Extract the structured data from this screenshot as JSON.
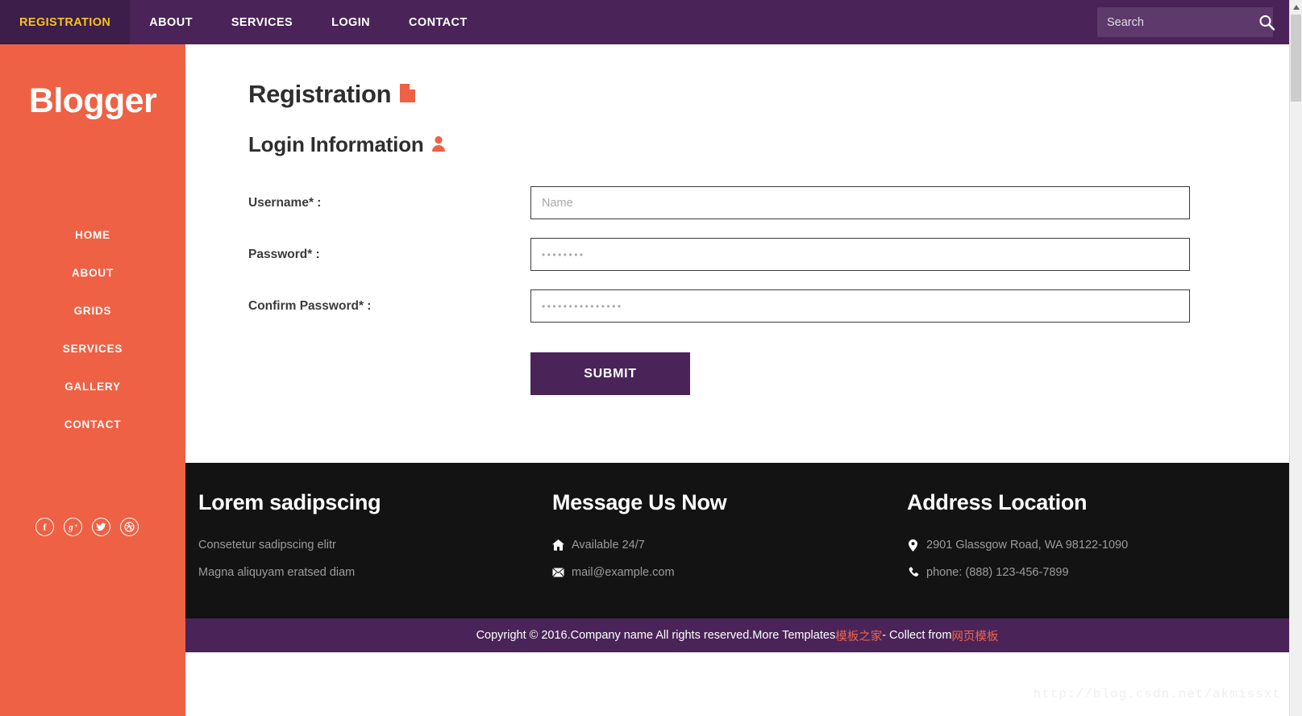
{
  "topnav": {
    "items": [
      {
        "label": "REGISTRATION",
        "active": true
      },
      {
        "label": "ABOUT",
        "active": false
      },
      {
        "label": "SERVICES",
        "active": false
      },
      {
        "label": "LOGIN",
        "active": false
      },
      {
        "label": "CONTACT",
        "active": false
      }
    ],
    "search": {
      "placeholder": "Search",
      "value": "",
      "icon": "search-icon"
    },
    "bg_color": "#4a2458",
    "active_color": "#f3c41c"
  },
  "sidebar": {
    "logo": "Blogger",
    "bg_color": "#ef6144",
    "items": [
      {
        "label": "HOME"
      },
      {
        "label": "ABOUT"
      },
      {
        "label": "GRIDS"
      },
      {
        "label": "SERVICES"
      },
      {
        "label": "GALLERY"
      },
      {
        "label": "CONTACT"
      }
    ],
    "socials": [
      {
        "name": "facebook-icon"
      },
      {
        "name": "google-plus-icon"
      },
      {
        "name": "twitter-icon"
      },
      {
        "name": "dribbble-icon"
      }
    ]
  },
  "main": {
    "title": "Registration",
    "title_icon": "file-icon",
    "subtitle": "Login Information",
    "subtitle_icon": "user-icon",
    "fields": [
      {
        "label": "Username* :",
        "placeholder": "Name",
        "value": "",
        "type": "text"
      },
      {
        "label": "Password* :",
        "placeholder": "••••••••",
        "value": "",
        "type": "password"
      },
      {
        "label": "Confirm Password* :",
        "placeholder": "•••••••••••••••",
        "value": "",
        "type": "password"
      }
    ],
    "submit_label": "SUBMIT",
    "submit_color": "#4a2458"
  },
  "footer": {
    "bg_color": "#131313",
    "columns": [
      {
        "heading": "Lorem sadipscing",
        "lines": [
          {
            "icon": "",
            "text": "Consetetur sadipscing elitr"
          },
          {
            "icon": "",
            "text": "Magna aliquyam eratsed diam"
          }
        ]
      },
      {
        "heading": "Message Us Now",
        "lines": [
          {
            "icon": "home-icon",
            "text": "Available 24/7"
          },
          {
            "icon": "envelope-icon",
            "text": "mail@example.com"
          }
        ]
      },
      {
        "heading": "Address Location",
        "lines": [
          {
            "icon": "map-pin-icon",
            "text": "2901 Glassgow Road, WA 98122-1090"
          },
          {
            "icon": "phone-icon",
            "text": "phone: (888) 123-456-7899"
          }
        ]
      }
    ]
  },
  "copyright": {
    "prefix": "Copyright © 2016.Company name All rights reserved.More Templates ",
    "link1": "模板之家",
    "middle": " - Collect from ",
    "link2": "网页模板",
    "link_color": "#f06449",
    "bg_color": "#4a2458"
  },
  "watermark": {
    "text": "http://blog.csdn.net/akmissxt"
  }
}
